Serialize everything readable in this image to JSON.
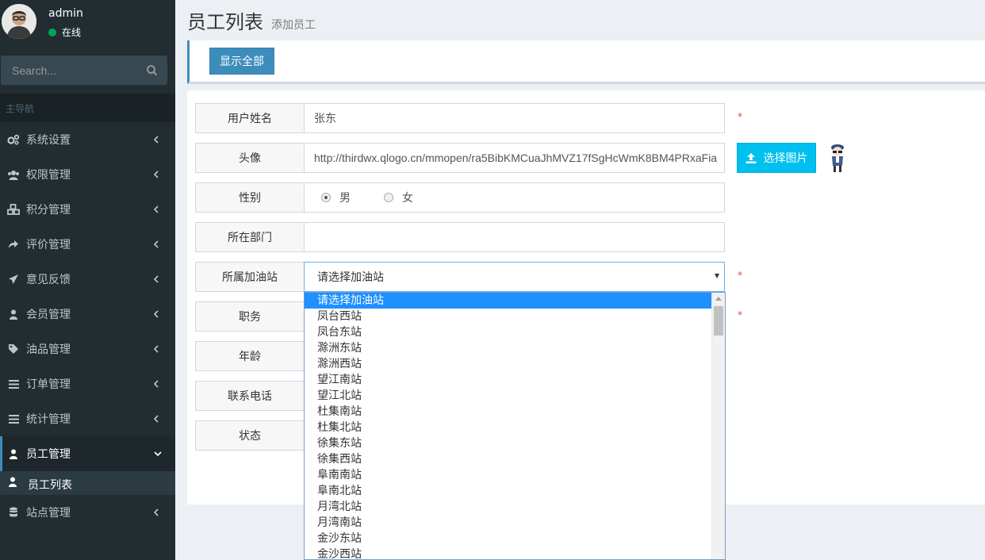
{
  "user": {
    "name": "admin",
    "status": "在线"
  },
  "search": {
    "placeholder": "Search..."
  },
  "sidebar": {
    "header": "主导航",
    "items": [
      {
        "label": "系统设置",
        "icon": "cogs-icon"
      },
      {
        "label": "权限管理",
        "icon": "users-icon"
      },
      {
        "label": "积分管理",
        "icon": "cubes-icon"
      },
      {
        "label": "评价管理",
        "icon": "share-icon"
      },
      {
        "label": "意见反馈",
        "icon": "paper-plane-icon"
      },
      {
        "label": "会员管理",
        "icon": "user-icon"
      },
      {
        "label": "油品管理",
        "icon": "tags-icon"
      },
      {
        "label": "订单管理",
        "icon": "bars-icon"
      },
      {
        "label": "统计管理",
        "icon": "bars-icon"
      },
      {
        "label": "员工管理",
        "icon": "user-icon"
      },
      {
        "label": "站点管理",
        "icon": "database-icon"
      }
    ],
    "sub_item": {
      "label": "员工列表",
      "icon": "user-icon"
    }
  },
  "header": {
    "title": "员工列表",
    "subtitle": "添加员工"
  },
  "toolbar": {
    "show_all_label": "显示全部"
  },
  "form": {
    "name": {
      "label": "用户姓名",
      "value": "张东"
    },
    "avatar": {
      "label": "头像",
      "value": "http://thirdwx.qlogo.cn/mmopen/ra5BibKMCuaJhMVZ17fSgHcWmK8BM4PRxaFia"
    },
    "gender": {
      "label": "性别",
      "options": [
        "男",
        "女"
      ],
      "selected": "男"
    },
    "department": {
      "label": "所在部门",
      "value": ""
    },
    "station": {
      "label": "所属加油站",
      "selected": "请选择加油站"
    },
    "position": {
      "label": "职务"
    },
    "age": {
      "label": "年龄"
    },
    "phone": {
      "label": "联系电话"
    },
    "status": {
      "label": "状态"
    },
    "required_mark": "*",
    "upload_label": "选择图片"
  },
  "dropdown": {
    "options": [
      "请选择加油站",
      "凤台西站",
      "凤台东站",
      "滁洲东站",
      "滁洲西站",
      "望江南站",
      "望江北站",
      "杜集南站",
      "杜集北站",
      "徐集东站",
      "徐集西站",
      "阜南南站",
      "阜南北站",
      "月湾北站",
      "月湾南站",
      "金沙东站",
      "金沙西站"
    ],
    "highlighted": 0
  },
  "colors": {
    "sidebar_bg": "#222d32",
    "primary": "#3c8dbc",
    "info": "#00c0ef",
    "highlight": "#1e90ff",
    "required": "#dd4b39"
  }
}
